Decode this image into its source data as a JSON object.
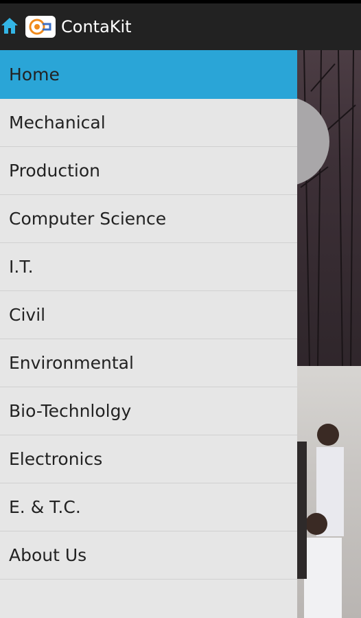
{
  "app": {
    "title": "ContaKit"
  },
  "icons": {
    "home": "home-icon",
    "logo": "app-logo-icon"
  },
  "colors": {
    "actionbar": "#222222",
    "drawer": "#e6e6e6",
    "selected": "#2aa5d7"
  },
  "drawer": {
    "items": [
      {
        "label": "Home",
        "selected": true
      },
      {
        "label": "Mechanical"
      },
      {
        "label": "Production"
      },
      {
        "label": "Computer Science"
      },
      {
        "label": "I.T."
      },
      {
        "label": "Civil"
      },
      {
        "label": "Environmental"
      },
      {
        "label": "Bio-Technlolgy"
      },
      {
        "label": "Electronics"
      },
      {
        "label": "E. & T.C."
      },
      {
        "label": "About Us"
      }
    ]
  }
}
